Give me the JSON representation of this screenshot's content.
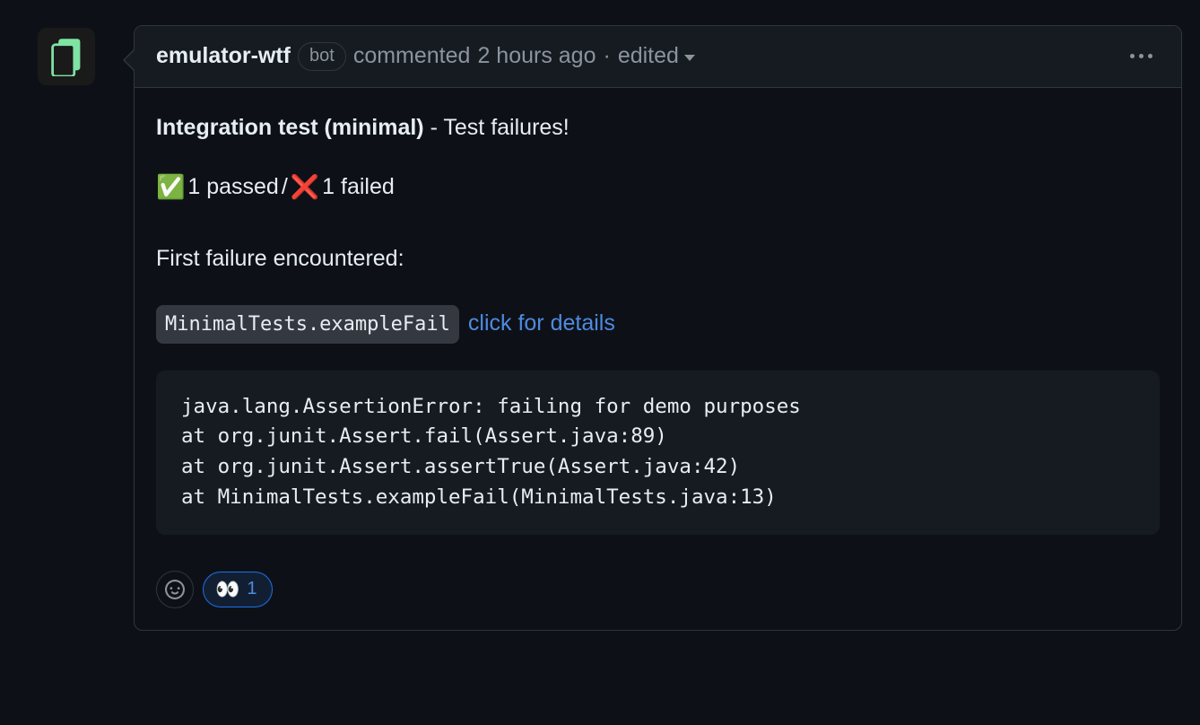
{
  "header": {
    "author": "emulator-wtf",
    "badge": "bot",
    "action": "commented",
    "timestamp": "2 hours ago",
    "edited": "edited"
  },
  "body": {
    "title_bold": "Integration test (minimal)",
    "title_rest": " - Test failures!",
    "results_passed": "1 passed",
    "results_sep": " / ",
    "results_failed": "1 failed",
    "first_failure_label": "First failure encountered:",
    "test_name": "MinimalTests.exampleFail",
    "details_link": "click for details",
    "stacktrace": "java.lang.AssertionError: failing for demo purposes\nat org.junit.Assert.fail(Assert.java:89)\nat org.junit.Assert.assertTrue(Assert.java:42)\nat MinimalTests.exampleFail(MinimalTests.java:13)"
  },
  "reactions": {
    "eyes_emoji": "👀",
    "eyes_count": "1"
  }
}
